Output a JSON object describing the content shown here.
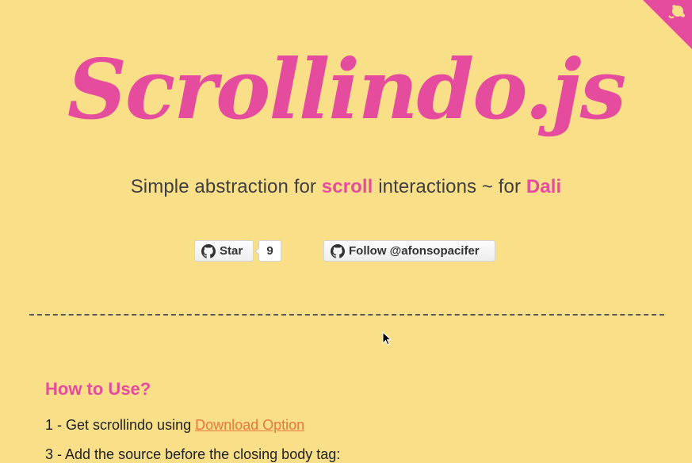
{
  "logo": {
    "text": "Scrollindo.js"
  },
  "tagline": {
    "part1": "Simple abstraction for ",
    "highlight1": "scroll",
    "part2": " interactions ~ for ",
    "highlight2": "Dali"
  },
  "github": {
    "star_label": "Star",
    "star_count": "9",
    "follow_label": "Follow @afonsopacifer"
  },
  "content": {
    "section_title": "How to Use?",
    "step1_prefix": "1 - Get scrollindo using ",
    "step1_link": "Download Option",
    "step3_text": "3 - Add the source before the closing body tag:"
  },
  "colors": {
    "background": "#fadf89",
    "accent": "#e64c9e",
    "link": "#e8783a"
  },
  "icons": {
    "corner": "github-octocat-icon",
    "star_button": "github-mark-icon",
    "follow_button": "github-mark-icon"
  }
}
